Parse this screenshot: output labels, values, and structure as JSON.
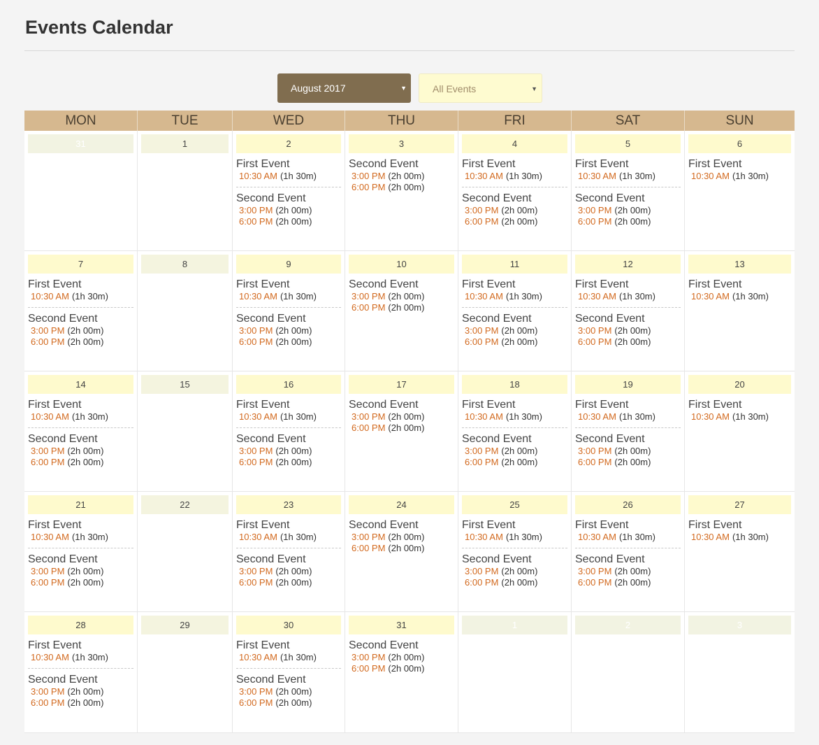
{
  "page_title": "Events Calendar",
  "controls": {
    "month_select": "August 2017",
    "filter_select": "All Events"
  },
  "weekdays": [
    "MON",
    "TUE",
    "WED",
    "THU",
    "FRI",
    "SAT",
    "SUN"
  ],
  "events": {
    "first": {
      "title": "First Event",
      "occurrences": [
        {
          "time": "10:30 AM",
          "duration": "(1h 30m)"
        }
      ]
    },
    "second": {
      "title": "Second Event",
      "occurrences": [
        {
          "time": "3:00 PM",
          "duration": "(2h 00m)"
        },
        {
          "time": "6:00 PM",
          "duration": "(2h 00m)"
        }
      ]
    }
  },
  "weeks": [
    [
      {
        "day": "31",
        "other_month": true,
        "events": []
      },
      {
        "day": "1",
        "events": []
      },
      {
        "day": "2",
        "events": [
          "first",
          "second"
        ]
      },
      {
        "day": "3",
        "events": [
          "second"
        ]
      },
      {
        "day": "4",
        "events": [
          "first",
          "second"
        ]
      },
      {
        "day": "5",
        "events": [
          "first",
          "second"
        ]
      },
      {
        "day": "6",
        "events": [
          "first"
        ]
      }
    ],
    [
      {
        "day": "7",
        "events": [
          "first",
          "second"
        ]
      },
      {
        "day": "8",
        "events": []
      },
      {
        "day": "9",
        "events": [
          "first",
          "second"
        ]
      },
      {
        "day": "10",
        "events": [
          "second"
        ]
      },
      {
        "day": "11",
        "events": [
          "first",
          "second"
        ]
      },
      {
        "day": "12",
        "events": [
          "first",
          "second"
        ]
      },
      {
        "day": "13",
        "events": [
          "first"
        ]
      }
    ],
    [
      {
        "day": "14",
        "events": [
          "first",
          "second"
        ]
      },
      {
        "day": "15",
        "events": []
      },
      {
        "day": "16",
        "events": [
          "first",
          "second"
        ]
      },
      {
        "day": "17",
        "events": [
          "second"
        ]
      },
      {
        "day": "18",
        "events": [
          "first",
          "second"
        ]
      },
      {
        "day": "19",
        "events": [
          "first",
          "second"
        ]
      },
      {
        "day": "20",
        "events": [
          "first"
        ]
      }
    ],
    [
      {
        "day": "21",
        "events": [
          "first",
          "second"
        ]
      },
      {
        "day": "22",
        "events": []
      },
      {
        "day": "23",
        "events": [
          "first",
          "second"
        ]
      },
      {
        "day": "24",
        "events": [
          "second"
        ]
      },
      {
        "day": "25",
        "events": [
          "first",
          "second"
        ]
      },
      {
        "day": "26",
        "events": [
          "first",
          "second"
        ]
      },
      {
        "day": "27",
        "events": [
          "first"
        ]
      }
    ],
    [
      {
        "day": "28",
        "events": [
          "first",
          "second"
        ]
      },
      {
        "day": "29",
        "events": []
      },
      {
        "day": "30",
        "events": [
          "first",
          "second"
        ]
      },
      {
        "day": "31",
        "events": [
          "second"
        ]
      },
      {
        "day": "1",
        "other_month": true,
        "events": []
      },
      {
        "day": "2",
        "other_month": true,
        "events": []
      },
      {
        "day": "3",
        "other_month": true,
        "events": []
      }
    ]
  ]
}
